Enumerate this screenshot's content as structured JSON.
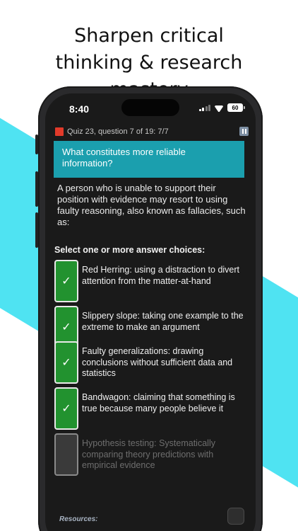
{
  "headline": {
    "line1": "Sharpen critical",
    "line2": "thinking & research",
    "line3": "mastery"
  },
  "status_bar": {
    "time": "8:40",
    "battery": "60"
  },
  "quiz": {
    "header": "Quiz 23, question 7 of 19: 7/7",
    "question": "What constitutes more reliable information?",
    "prompt": "A person who is unable to support their position with evidence may resort to using faulty reasoning, also known as fallacies, such as:",
    "instruction": "Select one or more answer choices:",
    "choices": [
      {
        "text": "Red Herring: using a distraction to divert attention from the matter-at-hand",
        "checked": true
      },
      {
        "text": "Slippery slope: taking one example to the extreme to make an argument",
        "checked": true
      },
      {
        "text": "Faulty generalizations: drawing conclusions without sufficient data and statistics",
        "checked": true
      },
      {
        "text": "Bandwagon: claiming that something is true because many people believe it",
        "checked": true
      },
      {
        "text": "Hypothesis testing: Systematically comparing theory predictions with empirical evidence",
        "checked": false
      }
    ],
    "resources_label": "Resources:"
  },
  "icons": {
    "check": "✓",
    "flag": "red-square-icon",
    "pause": "pause-icon"
  },
  "colors": {
    "accent_cyan": "#4fe3f2",
    "question_bg": "#1b9fae",
    "checked_green": "#22922f",
    "flag_red": "#e23a2a"
  }
}
